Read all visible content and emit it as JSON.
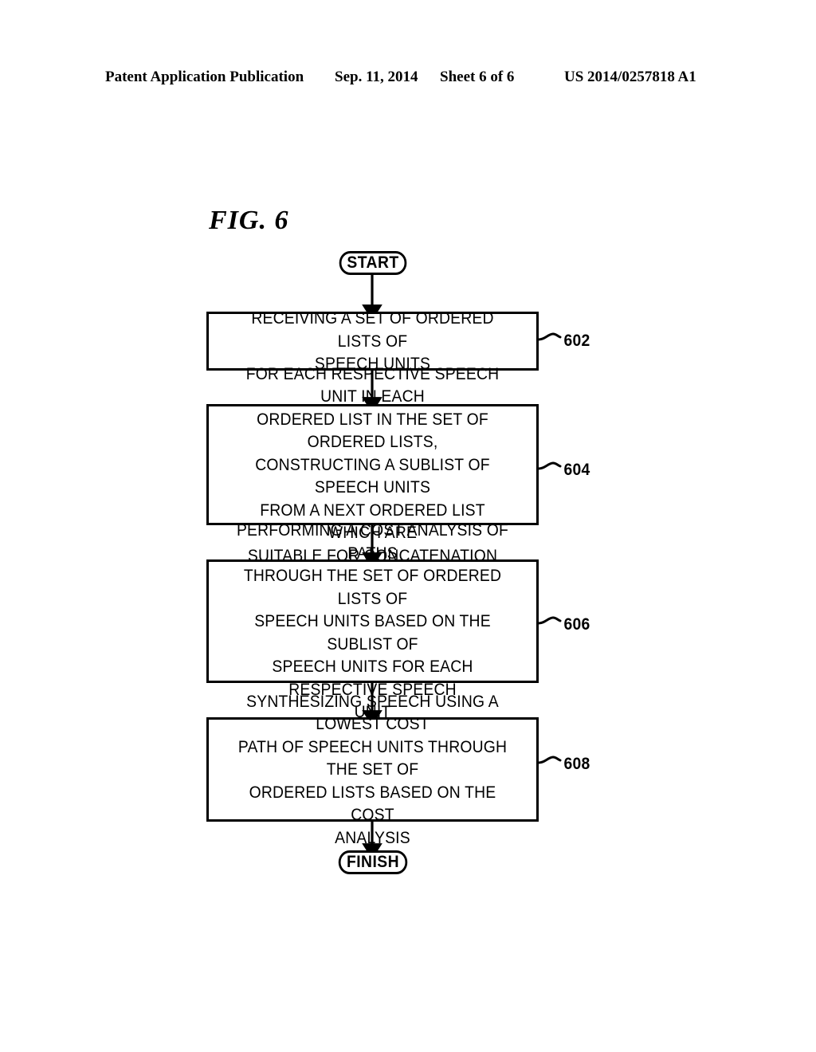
{
  "header": {
    "publication": "Patent Application Publication",
    "date": "Sep. 11, 2014",
    "sheet": "Sheet 6 of 6",
    "patent_number": "US 2014/0257818 A1"
  },
  "figure": {
    "label": "FIG. 6"
  },
  "flowchart": {
    "start_label": "START",
    "finish_label": "FINISH",
    "steps": [
      {
        "ref": "602",
        "text": "RECEIVING A SET OF ORDERED LISTS OF\nSPEECH UNITS"
      },
      {
        "ref": "604",
        "text": "FOR EACH RESPECTIVE SPEECH UNIT IN EACH\nORDERED LIST IN THE SET OF ORDERED LISTS,\nCONSTRUCTING A SUBLIST OF SPEECH UNITS\nFROM A NEXT ORDERED LIST WHICH ARE\nSUITABLE FOR CONCATENATION"
      },
      {
        "ref": "606",
        "text": "PERFORMING A COST ANALYSIS OF PATHS\nTHROUGH THE SET OF ORDERED LISTS OF\nSPEECH UNITS BASED ON THE SUBLIST OF\nSPEECH UNITS FOR EACH RESPECTIVE SPEECH\nUNIT"
      },
      {
        "ref": "608",
        "text": "SYNTHESIZING SPEECH USING A LOWEST COST\nPATH OF SPEECH UNITS THROUGH THE SET OF\nORDERED LISTS BASED ON THE COST\nANALYSIS"
      }
    ]
  },
  "colors": {
    "ink": "#000000",
    "paper": "#ffffff"
  }
}
